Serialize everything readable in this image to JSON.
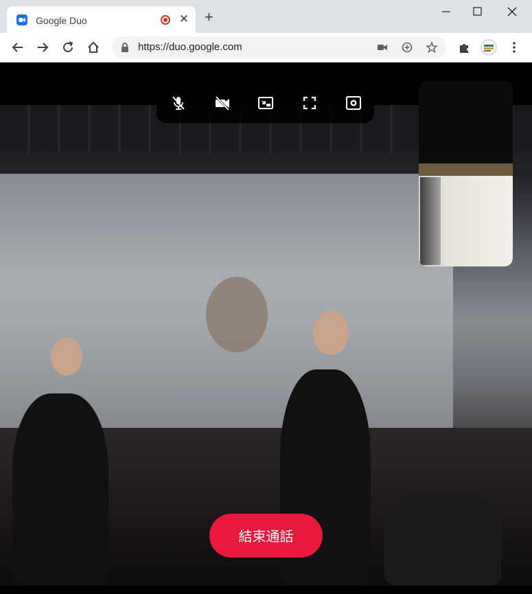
{
  "browser": {
    "tab_title": "Google Duo",
    "url": "https://duo.google.com",
    "accent": "#1a73e8"
  },
  "call": {
    "end_call_label": "結束通話",
    "end_call_color": "#e8193c",
    "controls": [
      "mic-off-icon",
      "camera-off-icon",
      "picture-in-picture-icon",
      "fullscreen-icon",
      "settings-icon"
    ]
  }
}
